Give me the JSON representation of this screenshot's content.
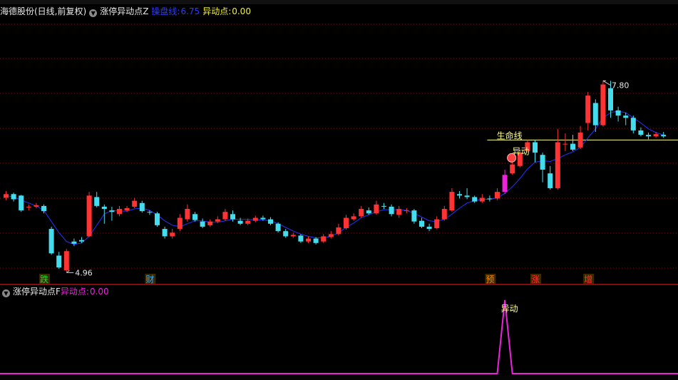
{
  "header": {
    "stock_name": "海德股份(日线,前复权)",
    "indicator_name": "涨停异动点Z",
    "line_label": "操盘线:",
    "line_value": "6.75",
    "signal_label": "异动点:",
    "signal_value": "0.00"
  },
  "sub_header": {
    "indicator_name": "涨停异动点F",
    "signal_label": "异动点:",
    "signal_value": "0.00"
  },
  "annotations": {
    "high_label": "7.80",
    "low_label": "4.96",
    "support_label": "生命线",
    "signal_text": "异动",
    "sub_signal_text": "异动"
  },
  "markers": [
    {
      "text": "跌",
      "color": "#22dd22",
      "bar": 5
    },
    {
      "text": "财",
      "color": "#33aaff",
      "bar": 19
    },
    {
      "text": "预",
      "color": "#ff8800",
      "bar": 64
    },
    {
      "text": "涨",
      "color": "#ff3333",
      "bar": 70
    },
    {
      "text": "增",
      "color": "#ff3333",
      "bar": 77
    }
  ],
  "colors": {
    "up": "#ff3333",
    "down": "#44ddee",
    "ma": "#2233ff",
    "grid": "#7a1010",
    "divider": "#b01010",
    "signal": "#ee22dd",
    "support": "#ffff88"
  },
  "chart_data": {
    "type": "candlestick",
    "ylim": [
      4.8,
      8.4
    ],
    "high": 7.8,
    "low": 4.96,
    "support_level": 6.75,
    "signal_bar": 66,
    "candles": [
      [
        5.97,
        6.02,
        6.06,
        5.94
      ],
      [
        6.02,
        5.95,
        6.04,
        5.92
      ],
      [
        6.0,
        5.8,
        6.01,
        5.78
      ],
      [
        5.85,
        5.85,
        5.88,
        5.8
      ],
      [
        5.85,
        5.87,
        5.9,
        5.83
      ],
      [
        5.86,
        5.79,
        5.88,
        5.76
      ],
      [
        5.55,
        5.22,
        5.58,
        5.2
      ],
      [
        5.19,
        5.03,
        5.24,
        5.01
      ],
      [
        4.99,
        5.25,
        5.28,
        4.96
      ],
      [
        5.38,
        5.35,
        5.42,
        5.32
      ],
      [
        5.4,
        5.38,
        5.44,
        5.36
      ],
      [
        5.45,
        6.0,
        6.05,
        5.44
      ],
      [
        5.98,
        5.86,
        6.05,
        5.84
      ],
      [
        5.85,
        5.82,
        5.88,
        5.62
      ],
      [
        5.8,
        5.78,
        5.85,
        5.66
      ],
      [
        5.75,
        5.82,
        5.86,
        5.72
      ],
      [
        5.8,
        5.83,
        5.86,
        5.78
      ],
      [
        5.85,
        5.93,
        5.97,
        5.83
      ],
      [
        5.9,
        5.79,
        5.93,
        5.77
      ],
      [
        5.78,
        5.77,
        5.8,
        5.74
      ],
      [
        5.76,
        5.6,
        5.78,
        5.58
      ],
      [
        5.55,
        5.45,
        5.58,
        5.42
      ],
      [
        5.45,
        5.5,
        5.55,
        5.42
      ],
      [
        5.55,
        5.7,
        5.75,
        5.52
      ],
      [
        5.68,
        5.82,
        5.88,
        5.65
      ],
      [
        5.75,
        5.67,
        5.78,
        5.65
      ],
      [
        5.65,
        5.58,
        5.69,
        5.56
      ],
      [
        5.6,
        5.65,
        5.68,
        5.58
      ],
      [
        5.65,
        5.68,
        5.72,
        5.63
      ],
      [
        5.68,
        5.78,
        5.82,
        5.66
      ],
      [
        5.75,
        5.68,
        5.8,
        5.65
      ],
      [
        5.66,
        5.62,
        5.7,
        5.6
      ],
      [
        5.62,
        5.66,
        5.69,
        5.6
      ],
      [
        5.66,
        5.7,
        5.73,
        5.64
      ],
      [
        5.7,
        5.68,
        5.73,
        5.66
      ],
      [
        5.68,
        5.62,
        5.71,
        5.6
      ],
      [
        5.62,
        5.52,
        5.64,
        5.5
      ],
      [
        5.52,
        5.45,
        5.55,
        5.43
      ],
      [
        5.45,
        5.47,
        5.5,
        5.43
      ],
      [
        5.46,
        5.38,
        5.48,
        5.36
      ],
      [
        5.38,
        5.42,
        5.45,
        5.36
      ],
      [
        5.42,
        5.36,
        5.44,
        5.34
      ],
      [
        5.38,
        5.45,
        5.48,
        5.36
      ],
      [
        5.44,
        5.48,
        5.52,
        5.42
      ],
      [
        5.48,
        5.57,
        5.62,
        5.46
      ],
      [
        5.56,
        5.7,
        5.74,
        5.54
      ],
      [
        5.68,
        5.72,
        5.76,
        5.66
      ],
      [
        5.72,
        5.82,
        5.86,
        5.7
      ],
      [
        5.8,
        5.76,
        5.84,
        5.74
      ],
      [
        5.76,
        5.88,
        5.93,
        5.74
      ],
      [
        5.86,
        5.85,
        5.9,
        5.82
      ],
      [
        5.85,
        5.75,
        5.88,
        5.72
      ],
      [
        5.74,
        5.82,
        5.86,
        5.7
      ],
      [
        5.8,
        5.8,
        5.83,
        5.76
      ],
      [
        5.8,
        5.65,
        5.82,
        5.62
      ],
      [
        5.66,
        5.58,
        5.7,
        5.56
      ],
      [
        5.58,
        5.55,
        5.62,
        5.52
      ],
      [
        5.56,
        5.68,
        5.72,
        5.55
      ],
      [
        5.68,
        5.82,
        5.86,
        5.66
      ],
      [
        5.8,
        6.05,
        6.1,
        5.78
      ],
      [
        6.02,
        6.0,
        6.06,
        5.96
      ],
      [
        6.0,
        5.98,
        6.1,
        5.95
      ],
      [
        5.98,
        5.92,
        6.0,
        5.9
      ],
      [
        5.92,
        5.97,
        6.02,
        5.9
      ],
      [
        5.96,
        5.95,
        6.0,
        5.92
      ],
      [
        5.96,
        6.05,
        6.1,
        5.94
      ],
      [
        6.05,
        6.28,
        6.35,
        6.02
      ],
      [
        6.3,
        6.42,
        6.5,
        6.28
      ],
      [
        6.4,
        6.58,
        6.62,
        6.38
      ],
      [
        6.6,
        6.72,
        6.75,
        6.58
      ],
      [
        6.72,
        6.58,
        6.75,
        6.45
      ],
      [
        6.55,
        6.35,
        6.58,
        6.18
      ],
      [
        6.3,
        6.1,
        6.4,
        6.08
      ],
      [
        6.1,
        6.72,
        6.9,
        6.08
      ],
      [
        6.7,
        6.7,
        6.84,
        6.6
      ],
      [
        6.7,
        6.62,
        6.82,
        6.6
      ],
      [
        6.65,
        6.85,
        6.94,
        6.63
      ],
      [
        6.98,
        7.35,
        7.4,
        6.88
      ],
      [
        7.25,
        6.95,
        7.3,
        6.86
      ],
      [
        6.95,
        7.5,
        7.55,
        6.93
      ],
      [
        7.45,
        7.15,
        7.55,
        7.05
      ],
      [
        7.15,
        7.08,
        7.2,
        7.0
      ],
      [
        7.08,
        7.05,
        7.12,
        6.95
      ],
      [
        7.05,
        6.88,
        7.08,
        6.84
      ],
      [
        6.88,
        6.82,
        6.92,
        6.8
      ],
      [
        6.82,
        6.8,
        6.85,
        6.76
      ],
      [
        6.8,
        6.83,
        6.86,
        6.78
      ],
      [
        6.82,
        6.8,
        6.86,
        6.78
      ]
    ],
    "ma": [
      6.0,
      5.98,
      5.94,
      5.9,
      5.86,
      5.8,
      5.65,
      5.5,
      5.38,
      5.34,
      5.36,
      5.45,
      5.6,
      5.75,
      5.8,
      5.79,
      5.79,
      5.82,
      5.83,
      5.8,
      5.74,
      5.66,
      5.6,
      5.58,
      5.62,
      5.66,
      5.66,
      5.64,
      5.64,
      5.66,
      5.68,
      5.68,
      5.68,
      5.67,
      5.67,
      5.66,
      5.62,
      5.57,
      5.52,
      5.48,
      5.45,
      5.43,
      5.43,
      5.45,
      5.5,
      5.57,
      5.63,
      5.7,
      5.74,
      5.78,
      5.81,
      5.81,
      5.81,
      5.8,
      5.76,
      5.71,
      5.66,
      5.65,
      5.68,
      5.75,
      5.83,
      5.9,
      5.93,
      5.95,
      5.95,
      5.97,
      6.03,
      6.12,
      6.23,
      6.36,
      6.45,
      6.47,
      6.46,
      6.5,
      6.55,
      6.59,
      6.65,
      6.78,
      6.9,
      7.05,
      7.12,
      7.14,
      7.12,
      7.05,
      6.98,
      6.9,
      6.85,
      6.82
    ],
    "sub_signal": [
      0,
      0,
      0,
      0,
      0,
      0,
      0,
      0,
      0,
      0,
      0,
      0,
      0,
      0,
      0,
      0,
      0,
      0,
      0,
      0,
      0,
      0,
      0,
      0,
      0,
      0,
      0,
      0,
      0,
      0,
      0,
      0,
      0,
      0,
      0,
      0,
      0,
      0,
      0,
      0,
      0,
      0,
      0,
      0,
      0,
      0,
      0,
      0,
      0,
      0,
      0,
      0,
      0,
      0,
      0,
      0,
      0,
      0,
      0,
      0,
      0,
      0,
      0,
      0,
      0,
      0,
      1,
      0,
      0,
      0,
      0,
      0,
      0,
      0,
      0,
      0,
      0,
      0,
      0,
      0,
      0,
      0,
      0,
      0,
      0,
      0,
      0,
      0
    ]
  }
}
